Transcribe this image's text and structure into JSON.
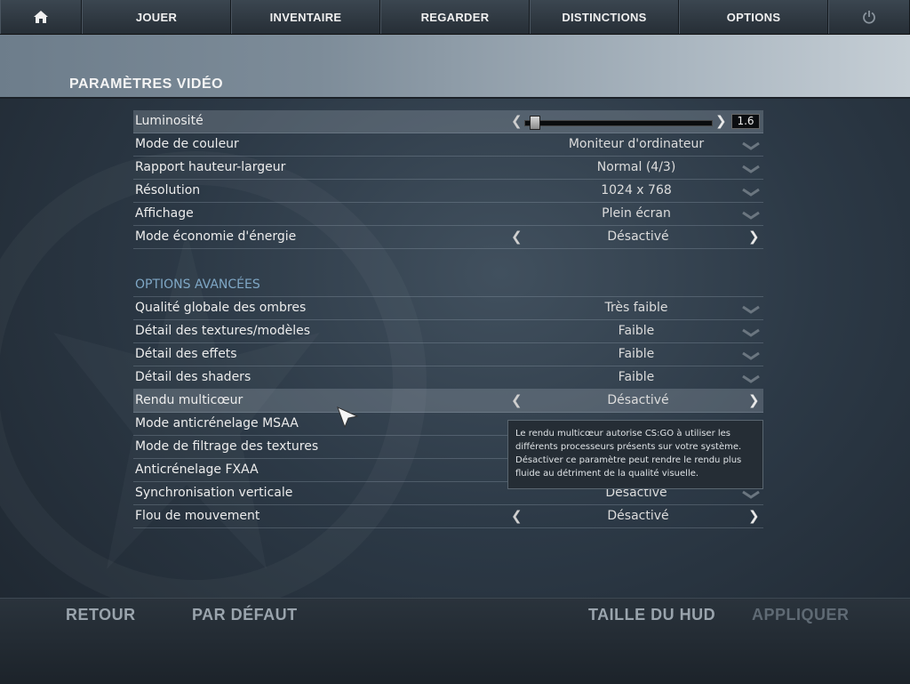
{
  "nav": {
    "home_icon": "home-icon",
    "items": [
      "JOUER",
      "INVENTAIRE",
      "REGARDER",
      "DISTINCTIONS",
      "OPTIONS"
    ],
    "power_icon": "power-icon"
  },
  "page": {
    "title": "PARAMÈTRES VIDÉO"
  },
  "settings": {
    "brightness": {
      "label": "Luminosité",
      "value": "1.6",
      "level": 0.02
    },
    "basic": [
      {
        "label": "Mode de couleur",
        "value": "Moniteur d'ordinateur",
        "control": "dropdown"
      },
      {
        "label": "Rapport hauteur-largeur",
        "value": "Normal (4/3)",
        "control": "dropdown"
      },
      {
        "label": "Résolution",
        "value": "1024 x 768",
        "control": "dropdown"
      },
      {
        "label": "Affichage",
        "value": "Plein écran",
        "control": "dropdown"
      },
      {
        "label": "Mode économie d'énergie",
        "value": "Désactivé",
        "control": "arrows"
      }
    ],
    "advanced_title": "OPTIONS AVANCÉES",
    "advanced": [
      {
        "label": "Qualité globale des ombres",
        "value": "Très faible",
        "control": "dropdown"
      },
      {
        "label": "Détail des textures/modèles",
        "value": "Faible",
        "control": "dropdown"
      },
      {
        "label": "Détail des effets",
        "value": "Faible",
        "control": "dropdown"
      },
      {
        "label": "Détail des shaders",
        "value": "Faible",
        "control": "dropdown"
      },
      {
        "label": "Rendu multicœur",
        "value": "Désactivé",
        "control": "arrows"
      },
      {
        "label": "Mode anticrénelage MSAA",
        "value": "",
        "control": "none"
      },
      {
        "label": "Mode de filtrage des textures",
        "value": "",
        "control": "none"
      },
      {
        "label": "Anticrénelage FXAA",
        "value": "",
        "control": "none"
      },
      {
        "label": "Synchronisation verticale",
        "value": "Désactivé",
        "control": "dropdown"
      },
      {
        "label": "Flou de mouvement",
        "value": "Désactivé",
        "control": "arrows"
      }
    ]
  },
  "tooltip": {
    "lines": [
      "Le rendu multicœur autorise CS:GO à utiliser les",
      "différents processeurs présents sur votre système.",
      "Désactiver ce paramètre peut rendre le rendu plus",
      "fluide au détriment de la qualité visuelle."
    ]
  },
  "footer": {
    "back": "RETOUR",
    "default": "PAR DÉFAUT",
    "hud_size": "TAILLE DU HUD",
    "apply": "APPLIQUER"
  }
}
